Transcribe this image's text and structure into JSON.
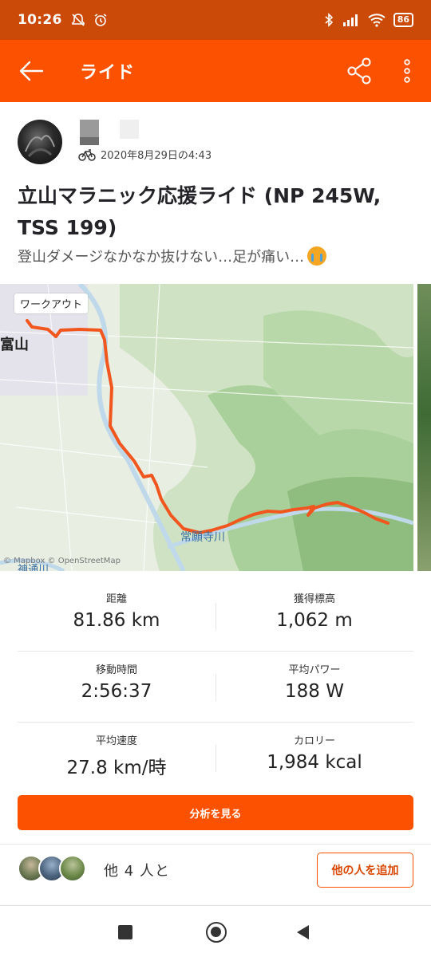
{
  "status_bar": {
    "time": "10:26",
    "battery": "86",
    "icons": [
      "mute-icon",
      "alarm-icon",
      "bluetooth-icon",
      "signal-icon",
      "wifi-icon",
      "battery-icon"
    ]
  },
  "app_bar": {
    "title": "ライド",
    "back_icon": "arrow-left-icon",
    "share_icon": "share-icon",
    "more_icon": "more-vertical-icon"
  },
  "activity": {
    "date": "2020年8月29日の4:43",
    "sport_icon": "bicycle-icon",
    "title": "立山マラニック応援ライド (NP 245W, TSS 199)",
    "description": "登山ダメージなかなか抜けない…足が痛い…",
    "description_emoji": "loudly-crying-face"
  },
  "map": {
    "badge": "ワークアウト",
    "city_label": "富山",
    "river_label": "常願寺川",
    "river_label_2": "神通川",
    "attribution": "© Mapbox © OpenStreetMap",
    "route_color": "#f0561e"
  },
  "stats": [
    {
      "label": "距離",
      "value": "81.86 km"
    },
    {
      "label": "獲得標高",
      "value": "1,062 m"
    },
    {
      "label": "移動時間",
      "value": "2:56:37"
    },
    {
      "label": "平均パワー",
      "value": "188 W"
    },
    {
      "label": "平均速度",
      "value": "27.8 km/時"
    },
    {
      "label": "カロリー",
      "value": "1,984 kcal"
    }
  ],
  "analyze_button": "分析を見る",
  "group": {
    "text": "他 4 人と",
    "add_button": "他の人を追加"
  },
  "colors": {
    "brand": "#fc5200",
    "status_bar": "#cc4a07"
  }
}
